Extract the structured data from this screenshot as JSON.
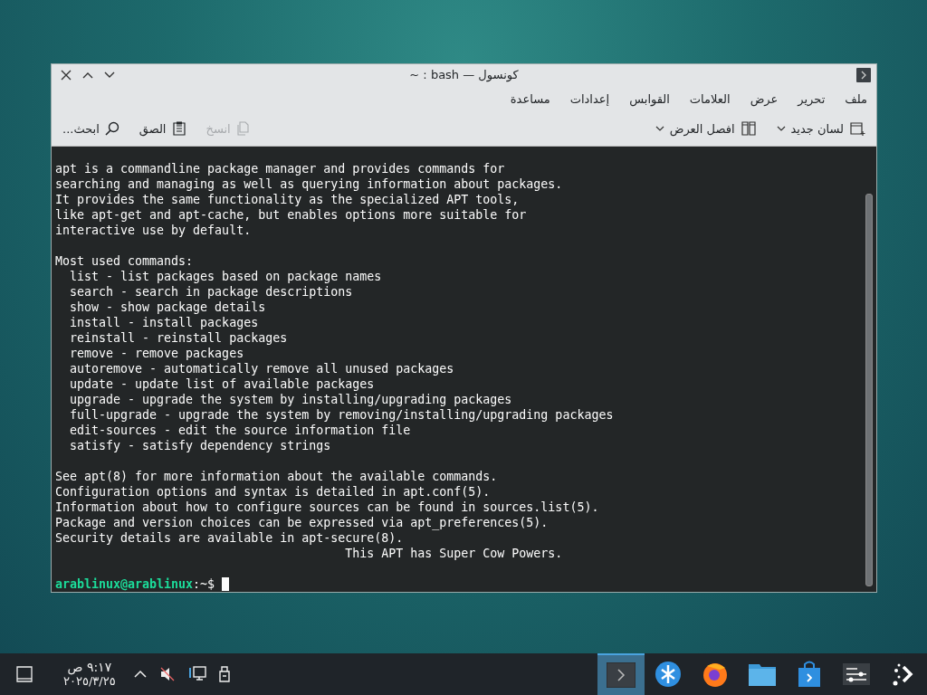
{
  "window": {
    "title": "كونسول — bash : ~"
  },
  "menu": [
    "ملف",
    "تحرير",
    "عرض",
    "العلامات",
    "القوابس",
    "إعدادات",
    "مساعدة"
  ],
  "toolbar": {
    "right": [
      {
        "kind": "new-tab",
        "label": "لسان جديد",
        "disabled": false
      },
      {
        "kind": "split",
        "label": "افصل العرض",
        "disabled": false
      }
    ],
    "left": [
      {
        "kind": "copy",
        "label": "انسخ",
        "disabled": true
      },
      {
        "kind": "paste",
        "label": "الصق",
        "disabled": false
      },
      {
        "kind": "find",
        "label": "ابحث...",
        "disabled": false
      }
    ]
  },
  "terminal": {
    "blocks": [
      [
        "apt is a commandline package manager and provides commands for",
        "searching and managing as well as querying information about packages.",
        "It provides the same functionality as the specialized APT tools,",
        "like apt-get and apt-cache, but enables options more suitable for",
        "interactive use by default."
      ],
      [
        "Most used commands:",
        "  list - list packages based on package names",
        "  search - search in package descriptions",
        "  show - show package details",
        "  install - install packages",
        "  reinstall - reinstall packages",
        "  remove - remove packages",
        "  autoremove - automatically remove all unused packages",
        "  update - update list of available packages",
        "  upgrade - upgrade the system by installing/upgrading packages",
        "  full-upgrade - upgrade the system by removing/installing/upgrading packages",
        "  edit-sources - edit the source information file",
        "  satisfy - satisfy dependency strings"
      ],
      [
        "See apt(8) for more information about the available commands.",
        "Configuration options and syntax is detailed in apt.conf(5).",
        "Information about how to configure sources can be found in sources.list(5).",
        "Package and version choices can be expressed via apt_preferences(5).",
        "Security details are available in apt-secure(8).",
        "                                        This APT has Super Cow Powers."
      ]
    ],
    "prompt_user": "arablinux@arablinux",
    "prompt_path": ":~$"
  },
  "taskbar": {
    "time": "٩:١٧ ص",
    "date": "٢٠٢٥/٣/٢٥",
    "apps": [
      {
        "kind": "terminal",
        "selected": true
      },
      {
        "kind": "network",
        "selected": false
      },
      {
        "kind": "browser",
        "selected": false
      },
      {
        "kind": "folder",
        "selected": false
      },
      {
        "kind": "store",
        "selected": false
      },
      {
        "kind": "settings",
        "selected": false
      },
      {
        "kind": "launcher",
        "selected": false
      }
    ]
  }
}
